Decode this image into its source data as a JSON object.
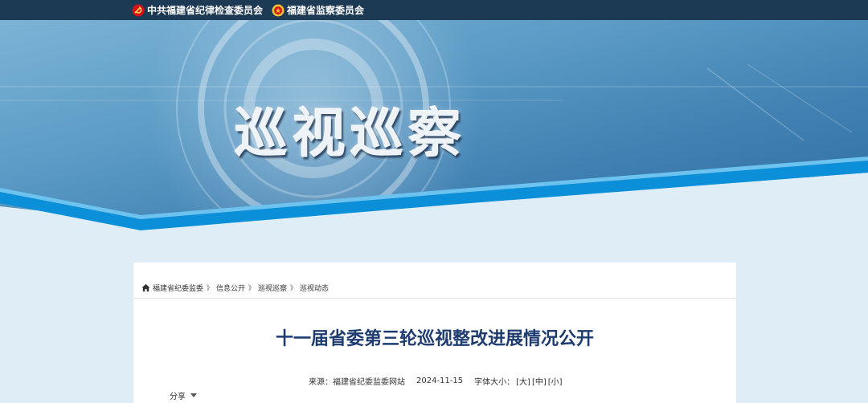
{
  "header": {
    "org_party": "中共福建省纪律检查委员会",
    "org_supervision": "福建省监察委员会",
    "banner_title": "巡视巡察"
  },
  "breadcrumb": {
    "items": [
      "福建省纪委监委",
      "信息公开",
      "巡视巡察",
      "巡视动态"
    ],
    "separator": "》"
  },
  "article": {
    "title": "十一届省委第三轮巡视整改进展情况公开",
    "source_label": "来源：",
    "source": "福建省纪委监委网站",
    "date": "2024-11-15",
    "font_size_label": "字体大小：",
    "font_large": "[大]",
    "font_medium": "[中]",
    "font_small": "[小]",
    "share_label": "分享"
  },
  "colors": {
    "topbar": "#1d3a55",
    "title": "#1e3c70",
    "banner_blue": "#3d7fb0",
    "stripe": "#0a8fd8"
  }
}
